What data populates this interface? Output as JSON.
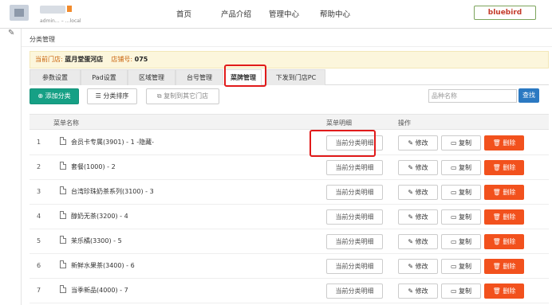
{
  "header": {
    "host_text": "admin… – …local",
    "nav": [
      "首页",
      "产品介绍",
      "管理中心",
      "帮助中心"
    ],
    "user": "bluebird"
  },
  "breadcrumb": "分类管理",
  "store": {
    "store_label": "当前门店:",
    "store_name": "蓝月堂蛋河店",
    "number_label": "店铺号:",
    "number": "075"
  },
  "tabs": [
    "参数设置",
    "Pad设置",
    "区域管理",
    "台号管理",
    "菜牌管理",
    "下发到门店PC"
  ],
  "active_tab": 4,
  "toolbar": {
    "add": "添加分类",
    "sort": "分类排序",
    "copy_other": "复制到其它门店",
    "search_placeholder": "品种名称",
    "search_btn": "查找"
  },
  "table": {
    "headers": [
      "菜单名称",
      "菜单明细",
      "操作"
    ],
    "detail_label": "当前分类明细",
    "edit_label": "修改",
    "copy_label": "复制",
    "delete_label": "删除",
    "rows": [
      {
        "idx": "1",
        "name": "会员卡专属(3901) - 1 -隐藏-"
      },
      {
        "idx": "2",
        "name": "套餐(1000) - 2"
      },
      {
        "idx": "3",
        "name": "台湾珍珠奶茶系列(3100) - 3"
      },
      {
        "idx": "4",
        "name": "醇奶无茶(3200) - 4"
      },
      {
        "idx": "5",
        "name": "茉乐橘(3300) - 5"
      },
      {
        "idx": "6",
        "name": "新鲜水果茶(3400) - 6"
      },
      {
        "idx": "7",
        "name": "当季新品(4000) - 7"
      }
    ]
  },
  "colors": {
    "accent_green": "#16a085",
    "danger": "#f2511d",
    "search_blue": "#2b79c2",
    "highlight_red": "#e11a1a"
  }
}
